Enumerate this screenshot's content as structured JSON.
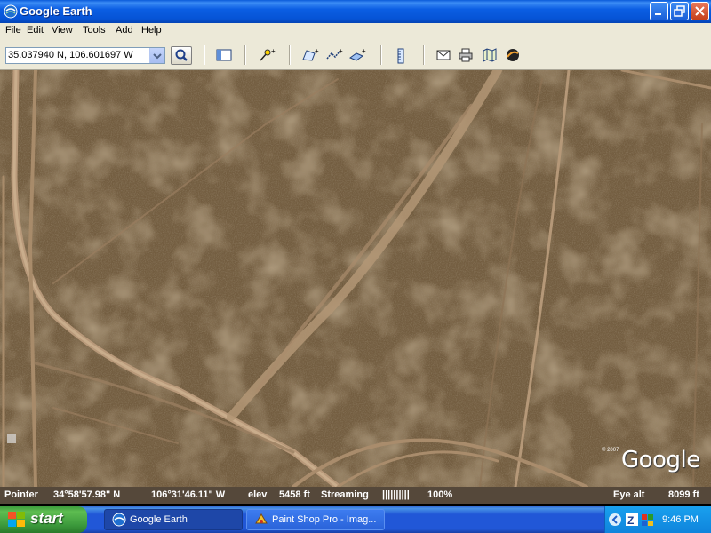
{
  "window": {
    "title": "Google Earth"
  },
  "menu": [
    "File",
    "Edit",
    "View",
    "Tools",
    "Add",
    "Help"
  ],
  "toolbar": {
    "location": "35.037940 N, 106.601697 W",
    "icons": [
      "search-icon",
      "sidebar-toggle-icon",
      "add-placemark-icon",
      "add-polygon-icon",
      "add-path-icon",
      "add-image-overlay-icon",
      "ruler-icon",
      "email-icon",
      "print-icon",
      "google-maps-icon",
      "sky-icon"
    ]
  },
  "map": {
    "copyright": "© 2007",
    "logo": "Google"
  },
  "status": {
    "pointer_label": "Pointer",
    "lat": "34°58'57.98\" N",
    "lon": "106°31'46.11\" W",
    "elev_label": "elev",
    "elev": "5458 ft",
    "streaming_label": "Streaming",
    "streaming_bars": "||||||||||",
    "streaming_pct": "100%",
    "eye_label": "Eye alt",
    "eye_alt": "8099 ft"
  },
  "taskbar": {
    "start": "start",
    "tasks": [
      {
        "label": "Google Earth",
        "active": true
      },
      {
        "label": "Paint Shop Pro - Imag...",
        "active": false
      }
    ],
    "clock": "9:46 PM"
  },
  "colors": {
    "title_blue": "#0654d6",
    "taskbar_blue": "#2157d7",
    "start_green": "#3c9a3c",
    "terrain": "#6f5a3e"
  }
}
